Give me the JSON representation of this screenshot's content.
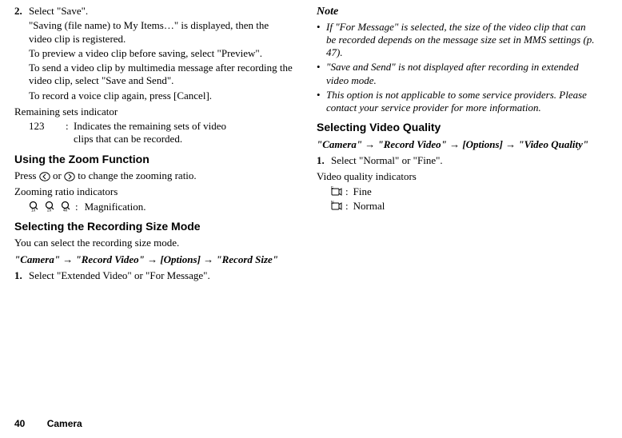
{
  "left": {
    "step2": {
      "num": "2.",
      "text": "Select \"Save\".",
      "body1": "\"Saving (file name) to My Items…\" is displayed, then the video clip is registered.",
      "body2": "To preview a video clip before saving, select \"Preview\".",
      "body3": "To send a video clip by multimedia message after recording the video clip, select \"Save and Send\".",
      "body4": "To record a voice clip again, press [Cancel]."
    },
    "remaining": {
      "label": "Remaining sets indicator",
      "key": "123",
      "val_line1": "Indicates the remaining sets of video",
      "val_line2": "clips that can be recorded."
    },
    "zoom": {
      "hdr": "Using the Zoom Function",
      "text_pre": "Press ",
      "text_mid": " or ",
      "text_post": " to change the zooming ratio.",
      "ind_label": "Zooming ratio indicators",
      "mag": "Magnification."
    },
    "recsize": {
      "hdr": "Selecting the Recording Size Mode",
      "intro": "You can select the recording size mode.",
      "path": "\"Camera\" → \"Record Video\" → [Options] → \"Record Size\"",
      "step1_num": "1.",
      "step1_text": "Select \"Extended Video\" or \"For Message\"."
    }
  },
  "right": {
    "note_hdr": "Note",
    "notes": [
      "If \"For Message\" is selected, the size of the video clip that can be recorded depends on the message size set in MMS settings (p. 47).",
      "\"Save and Send\" is not displayed after recording in extended video mode.",
      "This option is not applicable to some service providers. Please contact your service provider for more information."
    ],
    "quality": {
      "hdr": "Selecting Video Quality",
      "path": "\"Camera\" → \"Record Video\" → [Options] → \"Video Quality\"",
      "step1_num": "1.",
      "step1_text": "Select \"Normal\" or \"Fine\".",
      "ind_label": "Video quality indicators",
      "fine": "Fine",
      "normal": "Normal"
    }
  },
  "footer": {
    "page": "40",
    "section": "Camera"
  }
}
